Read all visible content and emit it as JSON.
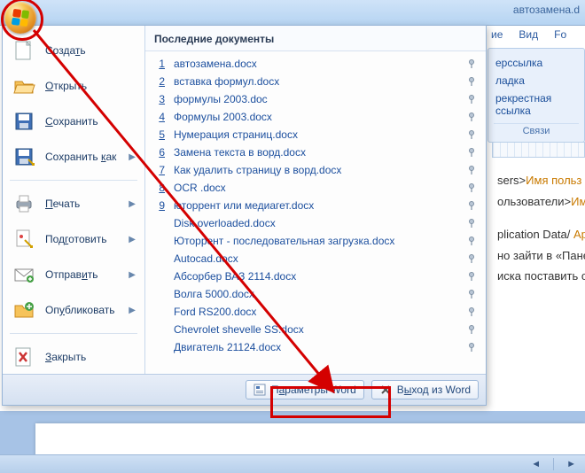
{
  "window_title": "автозамена.d",
  "ribbon": {
    "tabs_visible": [
      "ие",
      "Вид",
      "Fo"
    ],
    "group": {
      "links": [
        "ерссылка",
        "ладка",
        "рекрестная ссылка"
      ],
      "name": "Связи"
    }
  },
  "doc_fragments": [
    {
      "pre": "sers>",
      "hl": "Имя польз"
    },
    {
      "pre": "ользователи>",
      "hl": "Им"
    },
    {
      "pre": "plication Data/ ",
      "hl": "Ар"
    },
    {
      "pre": "но зайти в «Пане",
      "hl": ""
    },
    {
      "pre": "иска поставить от",
      "hl": ""
    }
  ],
  "office_menu": {
    "left": [
      {
        "icon": "new",
        "label_pre": "Созда",
        "label_u": "т",
        "label_post": "ь",
        "arrow": false
      },
      {
        "icon": "open",
        "label_pre": "",
        "label_u": "О",
        "label_post": "ткрыть",
        "arrow": false
      },
      {
        "icon": "save",
        "label_pre": "",
        "label_u": "С",
        "label_post": "охранить",
        "arrow": false
      },
      {
        "icon": "saveas",
        "label_pre": "Сохранить ",
        "label_u": "к",
        "label_post": "ак",
        "arrow": true
      },
      {
        "sep": true
      },
      {
        "icon": "print",
        "label_pre": "",
        "label_u": "П",
        "label_post": "ечать",
        "arrow": true
      },
      {
        "icon": "prepare",
        "label_pre": "Под",
        "label_u": "г",
        "label_post": "отовить",
        "arrow": true
      },
      {
        "icon": "send",
        "label_pre": "Отправ",
        "label_u": "и",
        "label_post": "ть",
        "arrow": true
      },
      {
        "icon": "publish",
        "label_pre": "Оп",
        "label_u": "у",
        "label_post": "бликовать",
        "arrow": true
      },
      {
        "sep": true
      },
      {
        "icon": "close",
        "label_pre": "",
        "label_u": "З",
        "label_post": "акрыть",
        "arrow": false
      }
    ],
    "recent_header": "Последние документы",
    "recent": [
      {
        "n": "1",
        "name": "автозамена.docx"
      },
      {
        "n": "2",
        "name": "вставка формул.docx"
      },
      {
        "n": "3",
        "name": "формулы 2003.doc"
      },
      {
        "n": "4",
        "name": "Формулы 2003.docx"
      },
      {
        "n": "5",
        "name": "Нумерация страниц.docx"
      },
      {
        "n": "6",
        "name": "Замена текста в ворд.docx"
      },
      {
        "n": "7",
        "name": "Как удалить страницу в ворд.docx"
      },
      {
        "n": "8",
        "name": "OCR .docx"
      },
      {
        "n": "9",
        "name": "юторрент или медиагет.docx"
      },
      {
        "n": "",
        "name": "Disk overloaded.docx"
      },
      {
        "n": "",
        "name": "Юторрент - последовательная загрузка.docx"
      },
      {
        "n": "",
        "name": "Autocad.docx"
      },
      {
        "n": "",
        "name": "Абсорбер ВАЗ 2114.docx"
      },
      {
        "n": "",
        "name": "Волга 5000.docx"
      },
      {
        "n": "",
        "name": "Ford RS200.docx"
      },
      {
        "n": "",
        "name": "Chevrolet shevelle SS.docx"
      },
      {
        "n": "",
        "name": "Двигатель 21124.docx"
      }
    ],
    "footer": {
      "options_pre": "П",
      "options_u": "а",
      "options_post": "раметры Word",
      "exit_pre": "В",
      "exit_u": "ы",
      "exit_post": "ход из Word"
    }
  },
  "status": {
    "left_arrow": "◄",
    "right_arrow": "►"
  }
}
